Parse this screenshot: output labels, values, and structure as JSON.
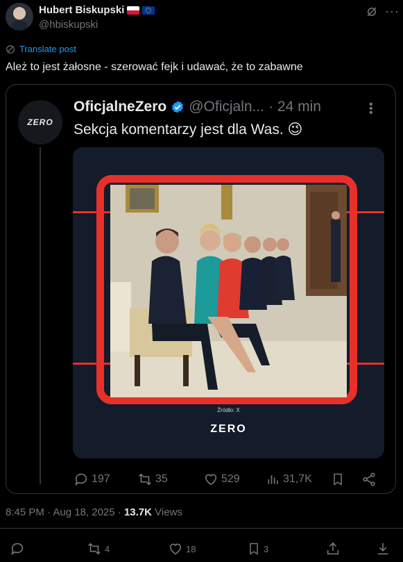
{
  "post": {
    "author_name": "Hubert Biskupski",
    "author_handle": "@hbiskupski",
    "translate_label": "Translate post",
    "text": "Ależ to jest żałosne - szerować fejk i udawać, że to zabawne",
    "timestamp": "8:45 PM · Aug 18, 2025 ·",
    "views_count": "13.7K",
    "views_label": "Views",
    "stats": {
      "replies": "",
      "reposts": "4",
      "likes": "18",
      "bookmarks": "3"
    }
  },
  "quoted": {
    "avatar_text": "ZERO",
    "name": "OficjalneZero",
    "handle": "@Oficjaln...",
    "time": "· 24 min",
    "text": "Sekcja komentarzy jest dla Was. 😉",
    "image": {
      "source_label": "Źródło: X",
      "logo_text": "ZERO"
    },
    "stats": {
      "replies": "197",
      "reposts": "35",
      "likes": "529",
      "views": "31,7K"
    }
  },
  "colors": {
    "accent": "#1d9bf0",
    "muted": "#71767b",
    "frame_red": "#e8302b"
  }
}
